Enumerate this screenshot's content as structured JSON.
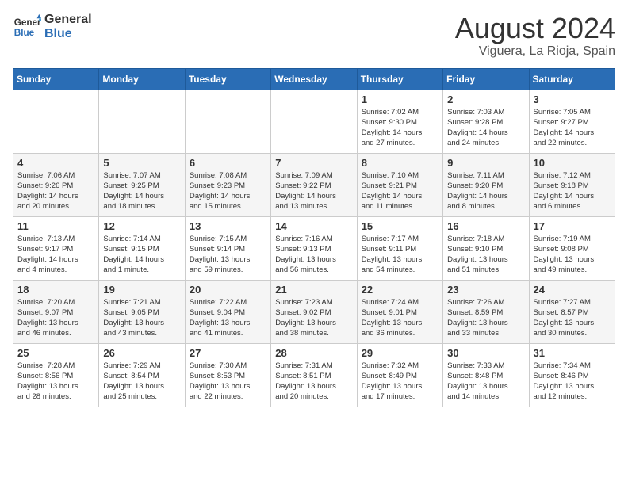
{
  "header": {
    "logo_line1": "General",
    "logo_line2": "Blue",
    "title": "August 2024",
    "subtitle": "Viguera, La Rioja, Spain"
  },
  "weekdays": [
    "Sunday",
    "Monday",
    "Tuesday",
    "Wednesday",
    "Thursday",
    "Friday",
    "Saturday"
  ],
  "weeks": [
    [
      {
        "day": "",
        "info": ""
      },
      {
        "day": "",
        "info": ""
      },
      {
        "day": "",
        "info": ""
      },
      {
        "day": "",
        "info": ""
      },
      {
        "day": "1",
        "info": "Sunrise: 7:02 AM\nSunset: 9:30 PM\nDaylight: 14 hours\nand 27 minutes."
      },
      {
        "day": "2",
        "info": "Sunrise: 7:03 AM\nSunset: 9:28 PM\nDaylight: 14 hours\nand 24 minutes."
      },
      {
        "day": "3",
        "info": "Sunrise: 7:05 AM\nSunset: 9:27 PM\nDaylight: 14 hours\nand 22 minutes."
      }
    ],
    [
      {
        "day": "4",
        "info": "Sunrise: 7:06 AM\nSunset: 9:26 PM\nDaylight: 14 hours\nand 20 minutes."
      },
      {
        "day": "5",
        "info": "Sunrise: 7:07 AM\nSunset: 9:25 PM\nDaylight: 14 hours\nand 18 minutes."
      },
      {
        "day": "6",
        "info": "Sunrise: 7:08 AM\nSunset: 9:23 PM\nDaylight: 14 hours\nand 15 minutes."
      },
      {
        "day": "7",
        "info": "Sunrise: 7:09 AM\nSunset: 9:22 PM\nDaylight: 14 hours\nand 13 minutes."
      },
      {
        "day": "8",
        "info": "Sunrise: 7:10 AM\nSunset: 9:21 PM\nDaylight: 14 hours\nand 11 minutes."
      },
      {
        "day": "9",
        "info": "Sunrise: 7:11 AM\nSunset: 9:20 PM\nDaylight: 14 hours\nand 8 minutes."
      },
      {
        "day": "10",
        "info": "Sunrise: 7:12 AM\nSunset: 9:18 PM\nDaylight: 14 hours\nand 6 minutes."
      }
    ],
    [
      {
        "day": "11",
        "info": "Sunrise: 7:13 AM\nSunset: 9:17 PM\nDaylight: 14 hours\nand 4 minutes."
      },
      {
        "day": "12",
        "info": "Sunrise: 7:14 AM\nSunset: 9:15 PM\nDaylight: 14 hours\nand 1 minute."
      },
      {
        "day": "13",
        "info": "Sunrise: 7:15 AM\nSunset: 9:14 PM\nDaylight: 13 hours\nand 59 minutes."
      },
      {
        "day": "14",
        "info": "Sunrise: 7:16 AM\nSunset: 9:13 PM\nDaylight: 13 hours\nand 56 minutes."
      },
      {
        "day": "15",
        "info": "Sunrise: 7:17 AM\nSunset: 9:11 PM\nDaylight: 13 hours\nand 54 minutes."
      },
      {
        "day": "16",
        "info": "Sunrise: 7:18 AM\nSunset: 9:10 PM\nDaylight: 13 hours\nand 51 minutes."
      },
      {
        "day": "17",
        "info": "Sunrise: 7:19 AM\nSunset: 9:08 PM\nDaylight: 13 hours\nand 49 minutes."
      }
    ],
    [
      {
        "day": "18",
        "info": "Sunrise: 7:20 AM\nSunset: 9:07 PM\nDaylight: 13 hours\nand 46 minutes."
      },
      {
        "day": "19",
        "info": "Sunrise: 7:21 AM\nSunset: 9:05 PM\nDaylight: 13 hours\nand 43 minutes."
      },
      {
        "day": "20",
        "info": "Sunrise: 7:22 AM\nSunset: 9:04 PM\nDaylight: 13 hours\nand 41 minutes."
      },
      {
        "day": "21",
        "info": "Sunrise: 7:23 AM\nSunset: 9:02 PM\nDaylight: 13 hours\nand 38 minutes."
      },
      {
        "day": "22",
        "info": "Sunrise: 7:24 AM\nSunset: 9:01 PM\nDaylight: 13 hours\nand 36 minutes."
      },
      {
        "day": "23",
        "info": "Sunrise: 7:26 AM\nSunset: 8:59 PM\nDaylight: 13 hours\nand 33 minutes."
      },
      {
        "day": "24",
        "info": "Sunrise: 7:27 AM\nSunset: 8:57 PM\nDaylight: 13 hours\nand 30 minutes."
      }
    ],
    [
      {
        "day": "25",
        "info": "Sunrise: 7:28 AM\nSunset: 8:56 PM\nDaylight: 13 hours\nand 28 minutes."
      },
      {
        "day": "26",
        "info": "Sunrise: 7:29 AM\nSunset: 8:54 PM\nDaylight: 13 hours\nand 25 minutes."
      },
      {
        "day": "27",
        "info": "Sunrise: 7:30 AM\nSunset: 8:53 PM\nDaylight: 13 hours\nand 22 minutes."
      },
      {
        "day": "28",
        "info": "Sunrise: 7:31 AM\nSunset: 8:51 PM\nDaylight: 13 hours\nand 20 minutes."
      },
      {
        "day": "29",
        "info": "Sunrise: 7:32 AM\nSunset: 8:49 PM\nDaylight: 13 hours\nand 17 minutes."
      },
      {
        "day": "30",
        "info": "Sunrise: 7:33 AM\nSunset: 8:48 PM\nDaylight: 13 hours\nand 14 minutes."
      },
      {
        "day": "31",
        "info": "Sunrise: 7:34 AM\nSunset: 8:46 PM\nDaylight: 13 hours\nand 12 minutes."
      }
    ]
  ]
}
